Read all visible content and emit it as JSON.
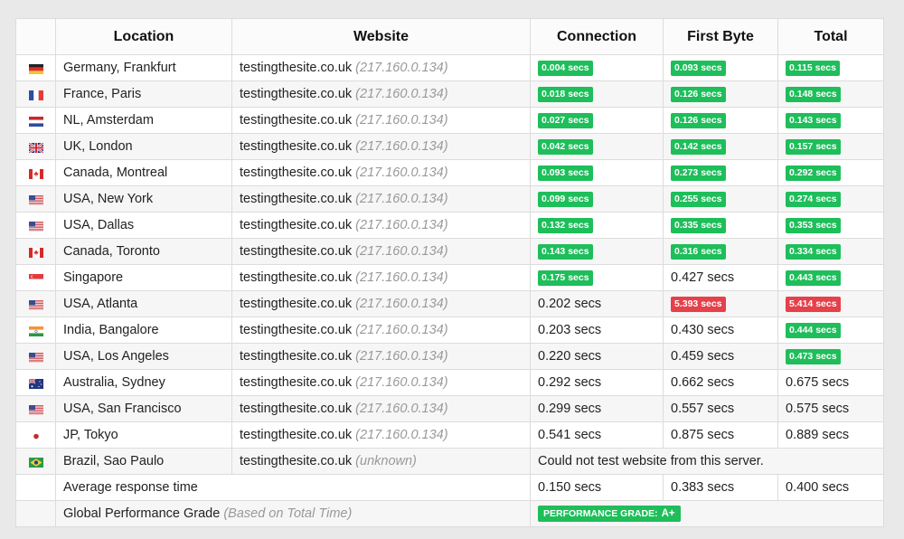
{
  "headers": {
    "flag": "",
    "location": "Location",
    "website": "Website",
    "connection": "Connection",
    "first_byte": "First Byte",
    "total": "Total"
  },
  "colors": {
    "good": "#1ebe5a",
    "bad": "#e6404a"
  },
  "rows": [
    {
      "flag": "de",
      "location": "Germany, Frankfurt",
      "site": "testingthesite.co.uk",
      "ip": "(217.160.0.134)",
      "connection": {
        "text": "0.004 secs",
        "status": "good"
      },
      "first_byte": {
        "text": "0.093 secs",
        "status": "good"
      },
      "total": {
        "text": "0.115 secs",
        "status": "good"
      }
    },
    {
      "flag": "fr",
      "location": "France, Paris",
      "site": "testingthesite.co.uk",
      "ip": "(217.160.0.134)",
      "connection": {
        "text": "0.018 secs",
        "status": "good"
      },
      "first_byte": {
        "text": "0.126 secs",
        "status": "good"
      },
      "total": {
        "text": "0.148 secs",
        "status": "good"
      }
    },
    {
      "flag": "nl",
      "location": "NL, Amsterdam",
      "site": "testingthesite.co.uk",
      "ip": "(217.160.0.134)",
      "connection": {
        "text": "0.027 secs",
        "status": "good"
      },
      "first_byte": {
        "text": "0.126 secs",
        "status": "good"
      },
      "total": {
        "text": "0.143 secs",
        "status": "good"
      }
    },
    {
      "flag": "uk",
      "location": "UK, London",
      "site": "testingthesite.co.uk",
      "ip": "(217.160.0.134)",
      "connection": {
        "text": "0.042 secs",
        "status": "good"
      },
      "first_byte": {
        "text": "0.142 secs",
        "status": "good"
      },
      "total": {
        "text": "0.157 secs",
        "status": "good"
      }
    },
    {
      "flag": "ca",
      "location": "Canada, Montreal",
      "site": "testingthesite.co.uk",
      "ip": "(217.160.0.134)",
      "connection": {
        "text": "0.093 secs",
        "status": "good"
      },
      "first_byte": {
        "text": "0.273 secs",
        "status": "good"
      },
      "total": {
        "text": "0.292 secs",
        "status": "good"
      }
    },
    {
      "flag": "us",
      "location": "USA, New York",
      "site": "testingthesite.co.uk",
      "ip": "(217.160.0.134)",
      "connection": {
        "text": "0.099 secs",
        "status": "good"
      },
      "first_byte": {
        "text": "0.255 secs",
        "status": "good"
      },
      "total": {
        "text": "0.274 secs",
        "status": "good"
      }
    },
    {
      "flag": "us",
      "location": "USA, Dallas",
      "site": "testingthesite.co.uk",
      "ip": "(217.160.0.134)",
      "connection": {
        "text": "0.132 secs",
        "status": "good"
      },
      "first_byte": {
        "text": "0.335 secs",
        "status": "good"
      },
      "total": {
        "text": "0.353 secs",
        "status": "good"
      }
    },
    {
      "flag": "ca",
      "location": "Canada, Toronto",
      "site": "testingthesite.co.uk",
      "ip": "(217.160.0.134)",
      "connection": {
        "text": "0.143 secs",
        "status": "good"
      },
      "first_byte": {
        "text": "0.316 secs",
        "status": "good"
      },
      "total": {
        "text": "0.334 secs",
        "status": "good"
      }
    },
    {
      "flag": "sg",
      "location": "Singapore",
      "site": "testingthesite.co.uk",
      "ip": "(217.160.0.134)",
      "connection": {
        "text": "0.175 secs",
        "status": "good"
      },
      "first_byte": {
        "text": "0.427 secs",
        "status": "plain"
      },
      "total": {
        "text": "0.443 secs",
        "status": "good"
      }
    },
    {
      "flag": "us",
      "location": "USA, Atlanta",
      "site": "testingthesite.co.uk",
      "ip": "(217.160.0.134)",
      "connection": {
        "text": "0.202 secs",
        "status": "plain"
      },
      "first_byte": {
        "text": "5.393 secs",
        "status": "bad"
      },
      "total": {
        "text": "5.414 secs",
        "status": "bad"
      }
    },
    {
      "flag": "in",
      "location": "India, Bangalore",
      "site": "testingthesite.co.uk",
      "ip": "(217.160.0.134)",
      "connection": {
        "text": "0.203 secs",
        "status": "plain"
      },
      "first_byte": {
        "text": "0.430 secs",
        "status": "plain"
      },
      "total": {
        "text": "0.444 secs",
        "status": "good"
      }
    },
    {
      "flag": "us",
      "location": "USA, Los Angeles",
      "site": "testingthesite.co.uk",
      "ip": "(217.160.0.134)",
      "connection": {
        "text": "0.220 secs",
        "status": "plain"
      },
      "first_byte": {
        "text": "0.459 secs",
        "status": "plain"
      },
      "total": {
        "text": "0.473 secs",
        "status": "good"
      }
    },
    {
      "flag": "au",
      "location": "Australia, Sydney",
      "site": "testingthesite.co.uk",
      "ip": "(217.160.0.134)",
      "connection": {
        "text": "0.292 secs",
        "status": "plain"
      },
      "first_byte": {
        "text": "0.662 secs",
        "status": "plain"
      },
      "total": {
        "text": "0.675 secs",
        "status": "plain"
      }
    },
    {
      "flag": "us",
      "location": "USA, San Francisco",
      "site": "testingthesite.co.uk",
      "ip": "(217.160.0.134)",
      "connection": {
        "text": "0.299 secs",
        "status": "plain"
      },
      "first_byte": {
        "text": "0.557 secs",
        "status": "plain"
      },
      "total": {
        "text": "0.575 secs",
        "status": "plain"
      }
    },
    {
      "flag": "jp",
      "location": "JP, Tokyo",
      "site": "testingthesite.co.uk",
      "ip": "(217.160.0.134)",
      "connection": {
        "text": "0.541 secs",
        "status": "plain"
      },
      "first_byte": {
        "text": "0.875 secs",
        "status": "plain"
      },
      "total": {
        "text": "0.889 secs",
        "status": "plain"
      }
    },
    {
      "flag": "br",
      "location": "Brazil, Sao Paulo",
      "site": "testingthesite.co.uk",
      "ip": "(unknown)",
      "error": "Could not test website from this server."
    }
  ],
  "average": {
    "label": "Average response time",
    "connection": "0.150 secs",
    "first_byte": "0.383 secs",
    "total": "0.400 secs"
  },
  "grade": {
    "label": "Global Performance Grade",
    "note": "(Based on Total Time)",
    "badge_text": "PERFORMANCE GRADE:",
    "badge_value": "A+"
  }
}
